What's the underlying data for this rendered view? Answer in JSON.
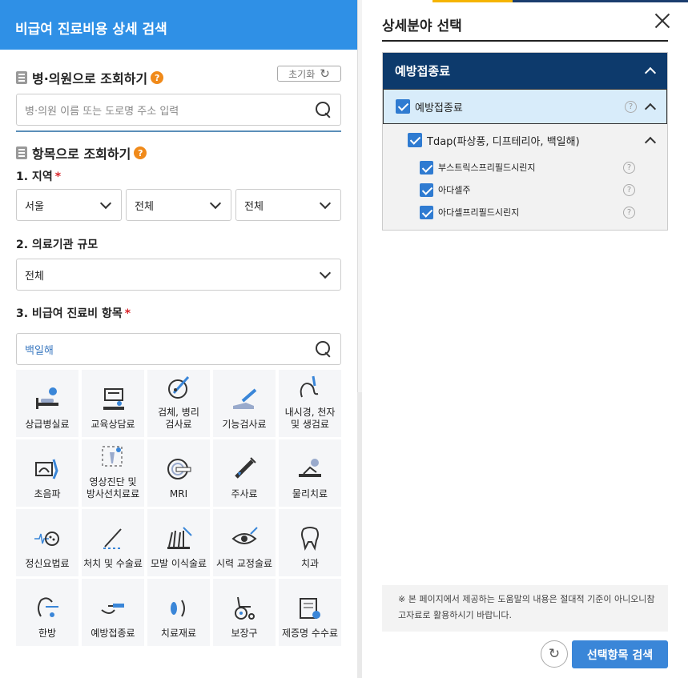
{
  "left": {
    "header_title": "비급여 진료비용 상세 검색",
    "hospital_section": {
      "title": "병·의원으로 조회하기",
      "help": "?",
      "reset_label": "초기화",
      "search_placeholder": "병·의원 이름 또는 도로명 주소 입력"
    },
    "item_section": {
      "title": "항목으로 조회하기",
      "help": "?",
      "region": {
        "label": "1. 지역",
        "required": "*",
        "values": [
          "서울",
          "전체",
          "전체"
        ]
      },
      "scale": {
        "label": "2. 의료기관 규모",
        "value": "전체"
      },
      "item": {
        "label": "3. 비급여 진료비 항목",
        "required": "*",
        "search_value": "백일해"
      }
    },
    "categories": [
      {
        "label": "상급병실료",
        "icon": "hospital-bed-icon"
      },
      {
        "label": "교육상담료",
        "icon": "counseling-icon"
      },
      {
        "label": "검체, 병리\n검사료",
        "icon": "specimen-icon"
      },
      {
        "label": "기능검사료",
        "icon": "function-test-icon"
      },
      {
        "label": "내시경, 천자\n및 생검료",
        "icon": "endoscopy-icon"
      },
      {
        "label": "초음파",
        "icon": "ultrasound-icon"
      },
      {
        "label": "영상진단 및\n방사선치료료",
        "icon": "imaging-icon"
      },
      {
        "label": "MRI",
        "icon": "mri-icon"
      },
      {
        "label": "주사료",
        "icon": "syringe-icon"
      },
      {
        "label": "물리치료",
        "icon": "physiotherapy-icon"
      },
      {
        "label": "정신요법료",
        "icon": "brain-wave-icon"
      },
      {
        "label": "처치 및 수술료",
        "icon": "surgery-icon"
      },
      {
        "label": "모발 이식술료",
        "icon": "hair-icon"
      },
      {
        "label": "시력 교정술료",
        "icon": "eye-icon"
      },
      {
        "label": "치과",
        "icon": "tooth-icon"
      },
      {
        "label": "한방",
        "icon": "acupuncture-icon"
      },
      {
        "label": "예방접종료",
        "icon": "vaccine-icon"
      },
      {
        "label": "치료재료",
        "icon": "material-icon"
      },
      {
        "label": "보장구",
        "icon": "wheelchair-icon"
      },
      {
        "label": "제증명 수수료",
        "icon": "certificate-icon"
      }
    ]
  },
  "right": {
    "title": "상세분야 선택",
    "tree": {
      "group": "예방접종료",
      "selected": "예방접종료",
      "sub_group": "Tdap(파상풍, 디프테리아, 백일해)",
      "items": [
        "부스트릭스프리필드시린지",
        "아다셀주",
        "아다셀프리필드시린지"
      ],
      "help": "?"
    },
    "notice": "※ 본 페이지에서 제공하는 도움말의 내용은 절대적 기준이 아니오니참고자료로 활용하시기 바랍니다.",
    "search_button": "선택항목 검색",
    "colors": {
      "accent": "#2f90e6",
      "tree_header": "#0d3a6c",
      "button": "#3a86d8",
      "checkbox": "#2f7bd1"
    }
  }
}
